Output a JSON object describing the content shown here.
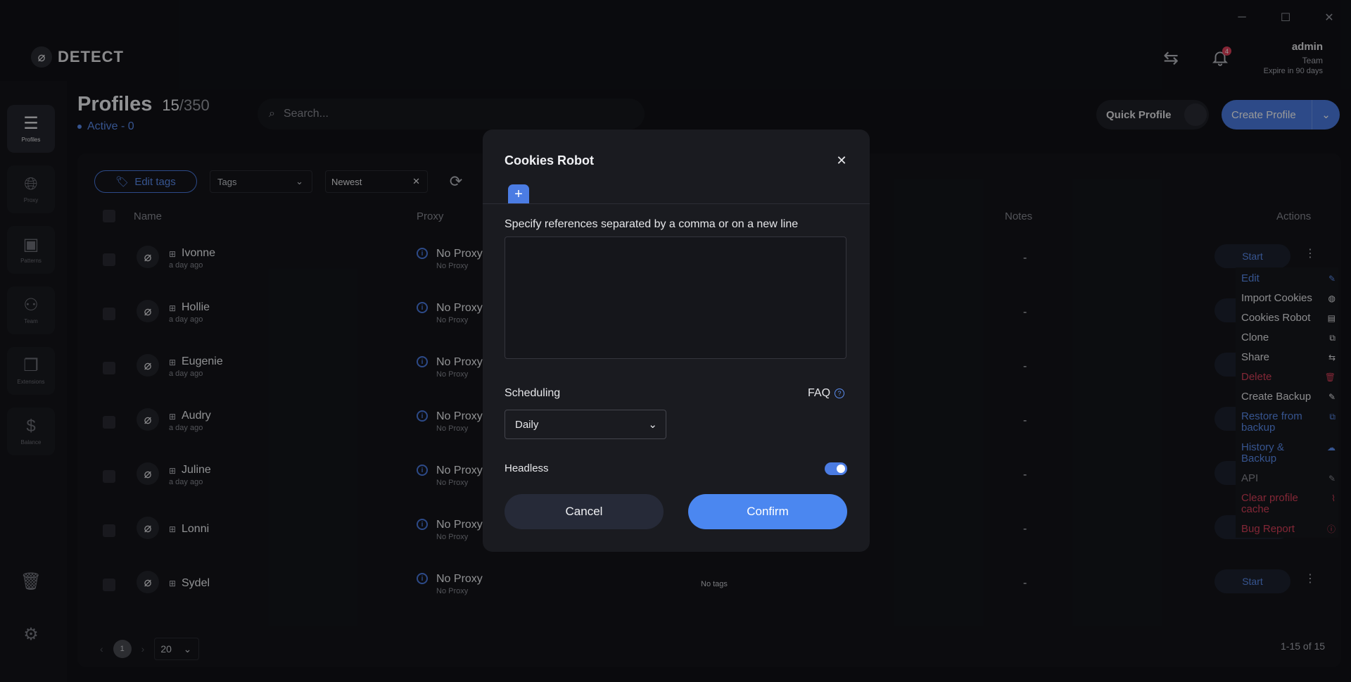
{
  "app": {
    "logo_text": "DETECT",
    "window_controls": {
      "minimize": "─",
      "maximize": "☐",
      "close": "✕"
    }
  },
  "header": {
    "notifications_count": "4",
    "user": {
      "name": "admin",
      "team": "Team",
      "expire": "Expire in 90 days"
    }
  },
  "sidebar": {
    "items": [
      {
        "label": "Profiles",
        "icon": "list-icon"
      },
      {
        "label": "Proxy",
        "icon": "globe-icon"
      },
      {
        "label": "Patterns",
        "icon": "patterns-icon"
      },
      {
        "label": "Team",
        "icon": "team-icon"
      },
      {
        "label": "Extensions",
        "icon": "extensions-icon"
      },
      {
        "label": "Balance",
        "icon": "dollar-icon"
      }
    ]
  },
  "page": {
    "title": "Profiles",
    "count": "15",
    "max": "/350",
    "active": "Active - 0",
    "search_placeholder": "Search...",
    "quick_profile": "Quick Profile",
    "create_profile": "Create Profile"
  },
  "toolbar": {
    "edit_tags": "Edit tags",
    "tags_placeholder": "Tags",
    "sort": "Newest"
  },
  "table": {
    "headers": {
      "name": "Name",
      "proxy": "Proxy",
      "notes": "Notes",
      "actions": "Actions"
    },
    "rows": [
      {
        "name": "Ivonne",
        "date": "a day ago",
        "proxy": "No Proxy",
        "proxy_sub": "No Proxy",
        "tags": "",
        "notes": "-",
        "start": "Start"
      },
      {
        "name": "Hollie",
        "date": "a day ago",
        "proxy": "No Proxy",
        "proxy_sub": "No Proxy",
        "tags": "",
        "notes": "-",
        "start": ""
      },
      {
        "name": "Eugenie",
        "date": "a day ago",
        "proxy": "No Proxy",
        "proxy_sub": "No Proxy",
        "tags": "",
        "notes": "-",
        "start": ""
      },
      {
        "name": "Audry",
        "date": "a day ago",
        "proxy": "No Proxy",
        "proxy_sub": "No Proxy",
        "tags": "",
        "notes": "-",
        "start": ""
      },
      {
        "name": "Juline",
        "date": "a day ago",
        "proxy": "No Proxy",
        "proxy_sub": "No Proxy",
        "tags": "",
        "notes": "-",
        "start": ""
      },
      {
        "name": "Lonni",
        "date": "",
        "proxy": "No Proxy",
        "proxy_sub": "No Proxy",
        "tags": "",
        "notes": "-",
        "start": ""
      },
      {
        "name": "Sydel",
        "date": "",
        "proxy": "No Proxy",
        "proxy_sub": "No Proxy",
        "tags": "No tags",
        "notes": "-",
        "start": "Start"
      }
    ]
  },
  "pagination": {
    "current": "1",
    "page_size": "20",
    "range": "1-15 of 15"
  },
  "context_menu": [
    {
      "label": "Edit",
      "color": "#5b8def",
      "icon": "pencil-icon"
    },
    {
      "label": "Import Cookies",
      "color": "#e6e7ea",
      "icon": "cookie-icon"
    },
    {
      "label": "Cookies Robot",
      "color": "#e6e7ea",
      "icon": "robot-icon"
    },
    {
      "label": "Clone",
      "color": "#e6e7ea",
      "icon": "copy-icon"
    },
    {
      "label": "Share",
      "color": "#e6e7ea",
      "icon": "share-icon"
    },
    {
      "label": "Delete",
      "color": "#d9415a",
      "icon": "trash-icon"
    },
    {
      "label": "Create Backup",
      "color": "#e6e7ea",
      "icon": "pencil-icon"
    },
    {
      "label": "Restore from backup",
      "color": "#5b8def",
      "icon": "copy-icon"
    },
    {
      "label": "History & Backup",
      "color": "#5b8def",
      "icon": "cloud-icon"
    },
    {
      "label": "API",
      "color": "#8a8c94",
      "icon": "pencil-icon"
    },
    {
      "label": "Clear profile cache",
      "color": "#d9415a",
      "icon": "broom-icon"
    },
    {
      "label": "Bug Report",
      "color": "#d9415a",
      "icon": "alert-icon"
    }
  ],
  "modal": {
    "title": "Cookies Robot",
    "references_label": "Specify references separated by a comma or on a new line",
    "references_value": "",
    "scheduling_label": "Scheduling",
    "faq": "FAQ",
    "schedule_value": "Daily",
    "headless_label": "Headless",
    "headless_on": true,
    "cancel": "Cancel",
    "confirm": "Confirm"
  }
}
